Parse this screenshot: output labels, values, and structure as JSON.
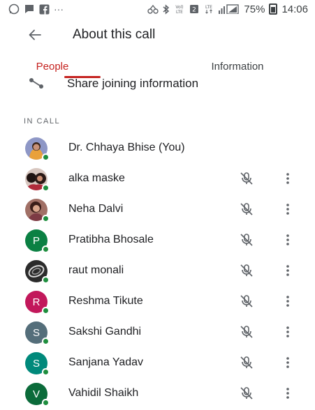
{
  "status_bar": {
    "left_icons": [
      "whatsapp-icon",
      "message-icon",
      "facebook-icon"
    ],
    "dots": "···",
    "right_icons": [
      "accessibility-icon",
      "bluetooth-icon",
      "volte-icon",
      "sim-icon",
      "lte-icon",
      "signal-icon"
    ],
    "battery": "75%",
    "time": "14:06"
  },
  "app_bar": {
    "title": "About this call",
    "back_icon": "arrow-back-icon"
  },
  "tabs": [
    {
      "label": "People",
      "selected": true
    },
    {
      "label": "Information",
      "selected": false
    }
  ],
  "accent_color": "#c5221f",
  "share_row": {
    "label": "Share joining information",
    "icon": "share-icon"
  },
  "section_label": "IN CALL",
  "participants": [
    {
      "name": "Dr. Chhaya Bhise (You)",
      "avatar": "photo",
      "initial": ""
    },
    {
      "name": "alka maske",
      "avatar": "photo",
      "initial": ""
    },
    {
      "name": "Neha Dalvi",
      "avatar": "photo",
      "initial": ""
    },
    {
      "name": "Pratibha Bhosale",
      "avatar": "initial",
      "initial": "P",
      "color": "#0b8043"
    },
    {
      "name": "raut monali",
      "avatar": "photo",
      "initial": ""
    },
    {
      "name": "Reshma Tikute",
      "avatar": "initial",
      "initial": "R",
      "color": "#c2185b"
    },
    {
      "name": "Sakshi Gandhi",
      "avatar": "initial",
      "initial": "S",
      "color": "#546e7a"
    },
    {
      "name": "Sanjana Yadav",
      "avatar": "initial",
      "initial": "S",
      "color": "#00897b"
    },
    {
      "name": "Vahidil Shaikh",
      "avatar": "initial",
      "initial": "V",
      "color": "#0b6b3a"
    }
  ]
}
